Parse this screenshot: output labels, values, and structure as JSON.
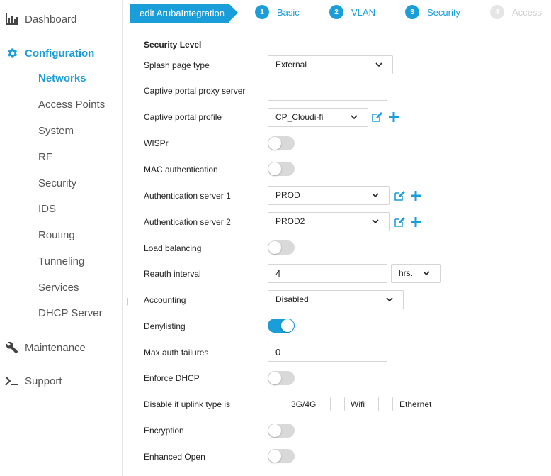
{
  "sidebar": {
    "dashboard": "Dashboard",
    "configuration": "Configuration",
    "items": [
      "Networks",
      "Access Points",
      "System",
      "RF",
      "Security",
      "IDS",
      "Routing",
      "Tunneling",
      "Services",
      "DHCP Server"
    ],
    "maintenance": "Maintenance",
    "support": "Support"
  },
  "wizard": {
    "edit_label": "edit ArubaIntegration",
    "steps": [
      {
        "num": "1",
        "label": "Basic"
      },
      {
        "num": "2",
        "label": "VLAN"
      },
      {
        "num": "3",
        "label": "Security"
      },
      {
        "num": "4",
        "label": "Access"
      }
    ]
  },
  "form": {
    "section_title": "Security Level",
    "splash_page_type": {
      "label": "Splash page type",
      "value": "External"
    },
    "captive_portal_proxy_server": {
      "label": "Captive portal proxy server",
      "value": ""
    },
    "captive_portal_profile": {
      "label": "Captive portal profile",
      "value": "CP_Cloudi-fi"
    },
    "wispr": {
      "label": "WISPr",
      "on": false
    },
    "mac_authentication": {
      "label": "MAC authentication",
      "on": false
    },
    "auth_server_1": {
      "label": "Authentication server 1",
      "value": "PROD"
    },
    "auth_server_2": {
      "label": "Authentication server 2",
      "value": "PROD2"
    },
    "load_balancing": {
      "label": "Load balancing",
      "on": false
    },
    "reauth_interval": {
      "label": "Reauth interval",
      "value": "4",
      "unit": "hrs."
    },
    "accounting": {
      "label": "Accounting",
      "value": "Disabled"
    },
    "denylisting": {
      "label": "Denylisting",
      "on": true
    },
    "max_auth_failures": {
      "label": "Max auth failures",
      "value": "0"
    },
    "enforce_dhcp": {
      "label": "Enforce DHCP",
      "on": false
    },
    "disable_uplink": {
      "label": "Disable if uplink type is",
      "options": [
        "3G/4G",
        "Wifi",
        "Ethernet"
      ]
    },
    "encryption": {
      "label": "Encryption",
      "on": false
    },
    "enhanced_open": {
      "label": "Enhanced Open",
      "on": false
    }
  },
  "colors": {
    "accent": "#1a9ed9",
    "toggle_off": "#d9d9d9",
    "disabled_step": "#cfcfcf"
  }
}
